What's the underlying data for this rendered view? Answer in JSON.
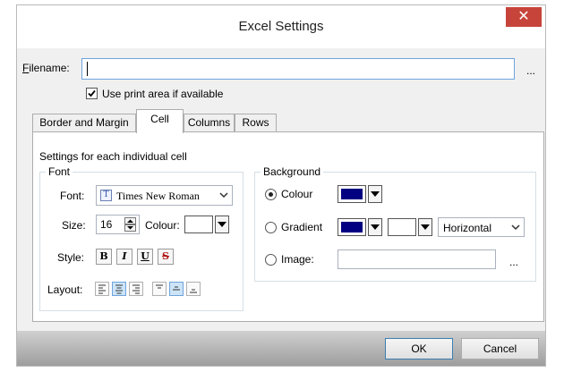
{
  "window": {
    "title": "Excel Settings",
    "close_glyph": "✕"
  },
  "filename": {
    "label_accel": "F",
    "label_rest": "ilename:",
    "value": "",
    "browse": "..."
  },
  "print_area": {
    "label": "Use print area if available",
    "checked": true
  },
  "tabs": [
    {
      "label": "Border and Margin"
    },
    {
      "label": "Cell",
      "active": true
    },
    {
      "label": "Columns"
    },
    {
      "label": "Rows"
    }
  ],
  "cell": {
    "description": "Settings for each individual cell",
    "font": {
      "group_label": "Font",
      "font_label": "Font:",
      "font_value": "Times New Roman",
      "size_label": "Size:",
      "size_value": "16",
      "colour_label": "Colour:",
      "style_label": "Style:",
      "style_buttons": [
        "B",
        "I",
        "U",
        "S"
      ],
      "layout_label": "Layout:"
    },
    "background": {
      "group_label": "Background",
      "colour_label": "Colour",
      "gradient_label": "Gradient",
      "image_label": "Image:",
      "selected": "Colour",
      "colour_value": "#000080",
      "gradient_color1": "#000080",
      "gradient_color2": "#ffffff",
      "gradient_direction": "Horizontal",
      "image_value": "",
      "image_browse": "..."
    }
  },
  "buttons": {
    "ok": "OK",
    "cancel": "Cancel"
  },
  "colors": {
    "accent": "#3c7fb1",
    "close": "#c7443a"
  }
}
